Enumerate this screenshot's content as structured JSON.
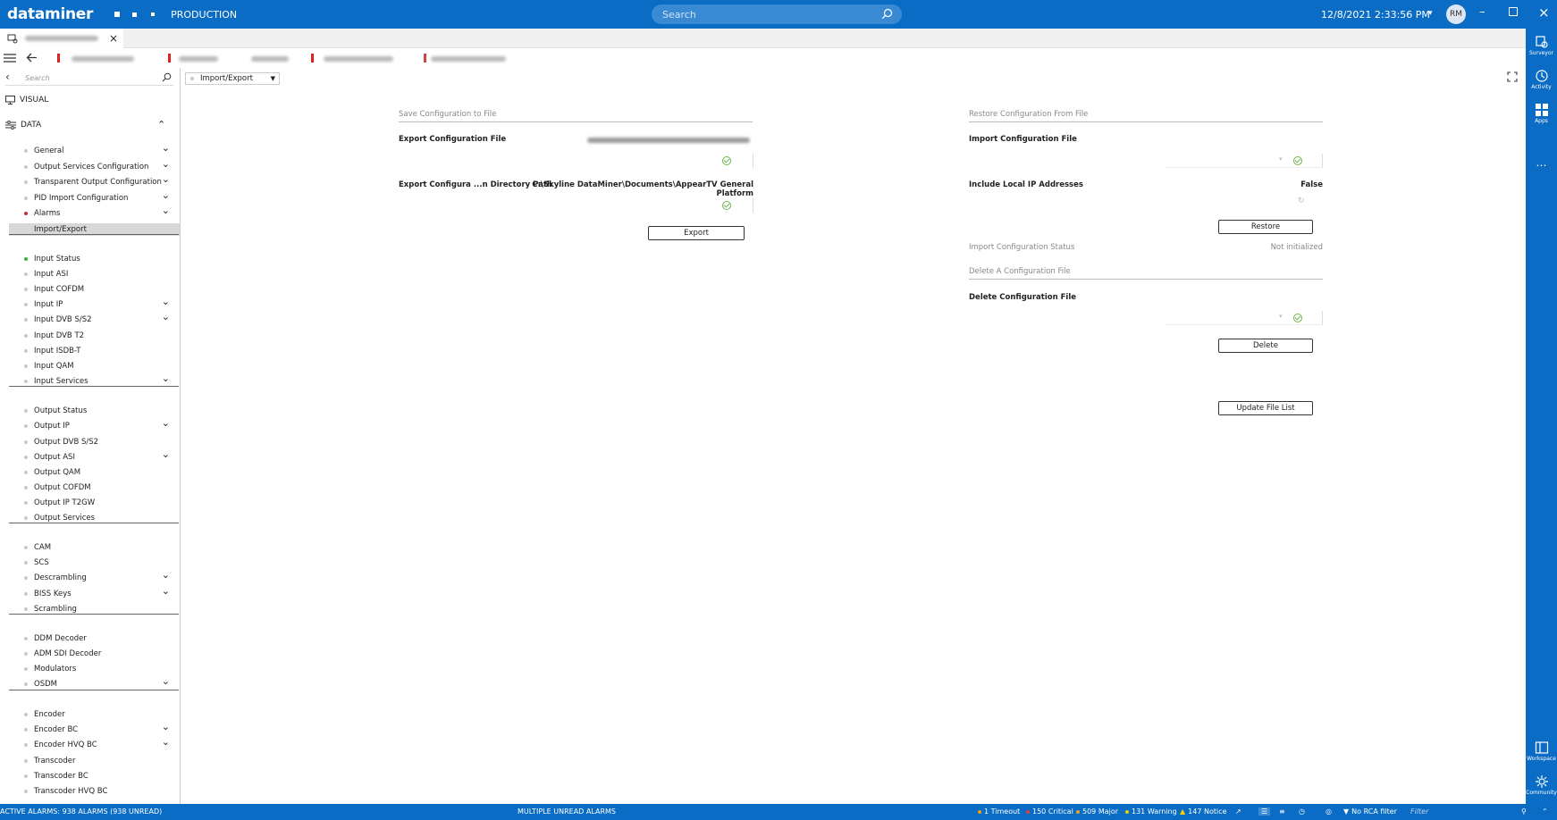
{
  "titlebar": {
    "logo": "dataminer",
    "environment": "PRODUCTION",
    "search_placeholder": "Search",
    "datetime": "12/8/2021 2:33:56 PM",
    "avatar_initials": "RM"
  },
  "right_apps": [
    {
      "label": "Surveyor"
    },
    {
      "label": "Activity"
    },
    {
      "label": "Apps"
    },
    {
      "label": "Workspace"
    },
    {
      "label": "Community"
    }
  ],
  "nav": {
    "search_placeholder": "Search",
    "visual_label": "VISUAL",
    "data_label": "DATA",
    "groups": [
      [
        {
          "label": "General",
          "dot": "#c8c8c8",
          "chevron": true
        },
        {
          "label": "Output Services Configuration",
          "dot": "#c8c8c8",
          "chevron": true
        },
        {
          "label": "Transparent Output Configuration",
          "dot": "#c8c8c8",
          "chevron": true
        },
        {
          "label": "PID Import Configuration",
          "dot": "#c8c8c8",
          "chevron": true
        },
        {
          "label": "Alarms",
          "dot": "#d22b2b",
          "chevron": true
        },
        {
          "label": "Import/Export",
          "dot": "",
          "chevron": false,
          "selected": true
        }
      ],
      [
        {
          "label": "Input Status",
          "dot": "#33b333",
          "chevron": false
        },
        {
          "label": "Input ASI",
          "dot": "#c8c8c8",
          "chevron": false
        },
        {
          "label": "Input COFDM",
          "dot": "#c8c8c8",
          "chevron": false
        },
        {
          "label": "Input IP",
          "dot": "#c8c8c8",
          "chevron": true
        },
        {
          "label": "Input DVB S/S2",
          "dot": "#c8c8c8",
          "chevron": true
        },
        {
          "label": "Input DVB T2",
          "dot": "#c8c8c8",
          "chevron": false
        },
        {
          "label": "Input ISDB-T",
          "dot": "#c8c8c8",
          "chevron": false
        },
        {
          "label": "Input QAM",
          "dot": "#c8c8c8",
          "chevron": false
        },
        {
          "label": "Input Services",
          "dot": "#c8c8c8",
          "chevron": true
        }
      ],
      [
        {
          "label": "Output Status",
          "dot": "#c8c8c8",
          "chevron": false
        },
        {
          "label": "Output IP",
          "dot": "#c8c8c8",
          "chevron": true
        },
        {
          "label": "Output DVB S/S2",
          "dot": "#c8c8c8",
          "chevron": false
        },
        {
          "label": "Output ASI",
          "dot": "#c8c8c8",
          "chevron": true
        },
        {
          "label": "Output QAM",
          "dot": "#c8c8c8",
          "chevron": false
        },
        {
          "label": "Output COFDM",
          "dot": "#c8c8c8",
          "chevron": false
        },
        {
          "label": "Output IP T2GW",
          "dot": "#c8c8c8",
          "chevron": false
        },
        {
          "label": "Output Services",
          "dot": "#c8c8c8",
          "chevron": false
        }
      ],
      [
        {
          "label": "CAM",
          "dot": "#c8c8c8",
          "chevron": false
        },
        {
          "label": "SCS",
          "dot": "#c8c8c8",
          "chevron": false
        },
        {
          "label": "Descrambling",
          "dot": "#c8c8c8",
          "chevron": true
        },
        {
          "label": "BISS Keys",
          "dot": "#c8c8c8",
          "chevron": true
        },
        {
          "label": "Scrambling",
          "dot": "#c8c8c8",
          "chevron": false
        }
      ],
      [
        {
          "label": "DDM Decoder",
          "dot": "#c8c8c8",
          "chevron": false
        },
        {
          "label": "ADM SDI Decoder",
          "dot": "#c8c8c8",
          "chevron": false
        },
        {
          "label": "Modulators",
          "dot": "#c8c8c8",
          "chevron": false
        },
        {
          "label": "OSDM",
          "dot": "#c8c8c8",
          "chevron": true
        }
      ],
      [
        {
          "label": "Encoder",
          "dot": "#c8c8c8",
          "chevron": false
        },
        {
          "label": "Encoder BC",
          "dot": "#c8c8c8",
          "chevron": true
        },
        {
          "label": "Encoder HVQ BC",
          "dot": "#c8c8c8",
          "chevron": true
        },
        {
          "label": "Transcoder",
          "dot": "#c8c8c8",
          "chevron": false
        },
        {
          "label": "Transcoder BC",
          "dot": "#c8c8c8",
          "chevron": false
        },
        {
          "label": "Transcoder HVQ BC",
          "dot": "#c8c8c8",
          "chevron": false
        }
      ]
    ]
  },
  "main": {
    "page_selector": "Import/Export",
    "save_section": {
      "title": "Save Configuration to File",
      "export_file_label": "Export Configuration File",
      "export_dir_label": "Export Configura ...n Directory Path",
      "export_dir_value": "C:\\Skyline DataMiner\\Documents\\AppearTV General Platform",
      "export_button": "Export"
    },
    "restore_section": {
      "title": "Restore Configuration From File",
      "import_file_label": "Import Configuration File",
      "include_ip_label": "Include Local IP Addresses",
      "include_ip_value": "False",
      "restore_button": "Restore",
      "status_label": "Import Configuration Status",
      "status_value": "Not initialized"
    },
    "delete_section": {
      "title": "Delete A Configuration File",
      "delete_file_label": "Delete Configuration File",
      "delete_button": "Delete",
      "update_button": "Update File List"
    }
  },
  "statusbar": {
    "active_alarms": "ACTIVE ALARMS: 938 ALARMS (938 UNREAD)",
    "message": "MULTIPLE UNREAD ALARMS",
    "timeout": "1 Timeout",
    "critical": "150 Critical",
    "major": "509 Major",
    "warning": "131 Warning",
    "notice": "147 Notice",
    "rca": "No RCA filter",
    "filter_placeholder": "Filter"
  },
  "colors": {
    "brand": "#0a6cc4",
    "critical": "#e0413a",
    "major": "#f0a020",
    "warning": "#e6d300",
    "timeout": "#c8a0ff",
    "ok": "#6ab84d"
  }
}
